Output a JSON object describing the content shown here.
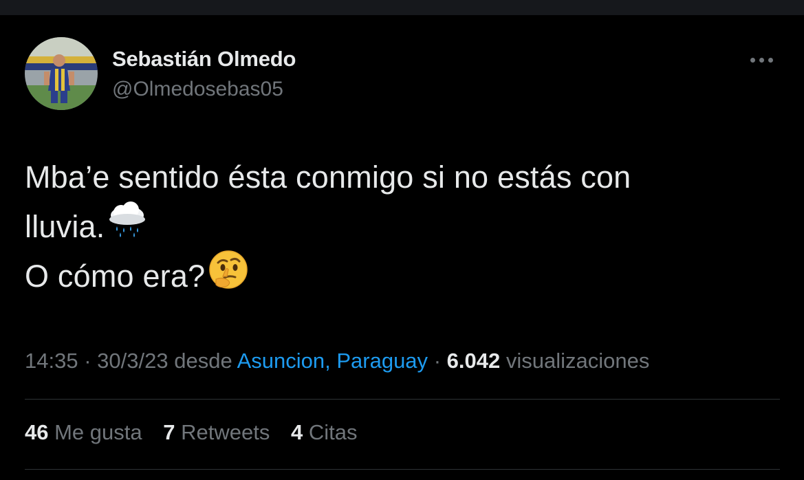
{
  "tweet": {
    "author": {
      "display_name": "Sebastián Olmedo",
      "handle": "@Olmedosebas05",
      "avatar_icon": "player-photo-avatar"
    },
    "more_icon": "more-horizontal-icon",
    "text_lines": [
      {
        "text": "Mba’e sentido ésta conmigo si no estás con"
      },
      {
        "text": "lluvia.",
        "emoji": "rain-cloud-emoji"
      },
      {
        "text": "O cómo era?",
        "emoji": "thinking-face-emoji"
      }
    ],
    "meta": {
      "time": "14:35",
      "separator": "·",
      "date": "30/3/23",
      "from_label": "desde",
      "location": "Asuncion, Paraguay",
      "views_count": "6.042",
      "views_label": "visualizaciones"
    },
    "stats": {
      "likes": {
        "count": "46",
        "label": "Me gusta"
      },
      "retweets": {
        "count": "7",
        "label": "Retweets"
      },
      "quotes": {
        "count": "4",
        "label": "Citas"
      }
    }
  },
  "colors": {
    "background": "#000000",
    "primary_text": "#e7e9ea",
    "secondary_text": "#71767b",
    "link": "#1d9bf0",
    "divider": "#2f3336"
  }
}
